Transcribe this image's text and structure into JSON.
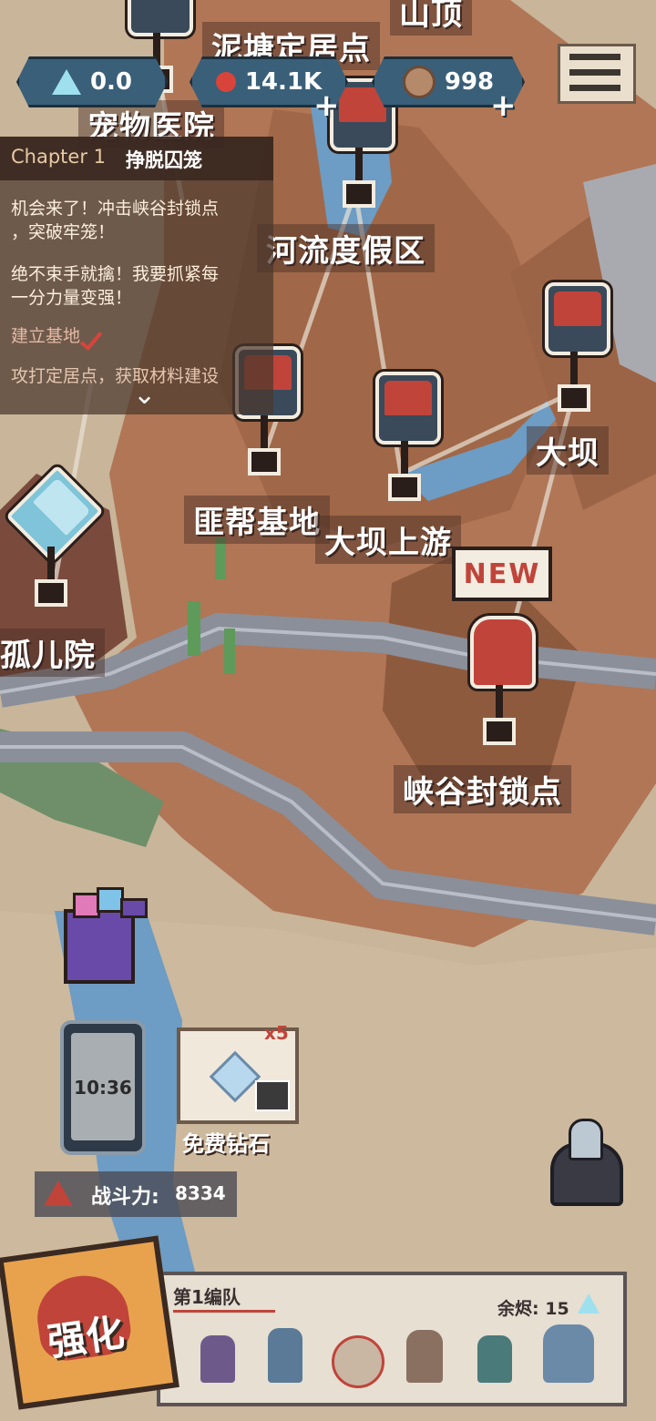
{
  "resources": {
    "stat_a": "0.0",
    "stat_b": "14.1K",
    "stat_c": "998",
    "plus": "+"
  },
  "chapter": {
    "number": "Chapter 1",
    "name": "挣脱囚笼",
    "lines": [
      "机会来了！冲击峡谷封锁点",
      "，突破牢笼！",
      "绝不束手就擒！我要抓紧每",
      "一分力量变强！",
      "建立基地",
      "攻打定居点，获取材料建设"
    ],
    "expand": "⌄"
  },
  "locations": {
    "top_partial": "山顶",
    "pond": "泥塘定居点",
    "pet_hospital": "宠物医院",
    "river_resort": "河流度假区",
    "dam": "大坝",
    "bandit_base": "匪帮基地",
    "dam_upstream": "大坝上游",
    "orphanage": "孤儿院",
    "canyon": "峡谷封锁点"
  },
  "new_badge": "NEW",
  "phone": {
    "time": "10:36"
  },
  "free_gems": {
    "label": "免费钻石",
    "multiplier": "x5"
  },
  "power": {
    "label": "战斗力:",
    "value": "8334"
  },
  "upgrade_button": "强化",
  "team": {
    "name": "第1编队",
    "remaining_label": "余烬:",
    "remaining_value": "15",
    "members": [
      "member-1",
      "member-2",
      "member-3",
      "member-4",
      "member-5",
      "member-6"
    ]
  },
  "colors": {
    "accent_red": "#c0443a",
    "panel_dark": "#4b372d",
    "resource_blue": "#3a5f78",
    "map_tan": "#c8b59a"
  }
}
